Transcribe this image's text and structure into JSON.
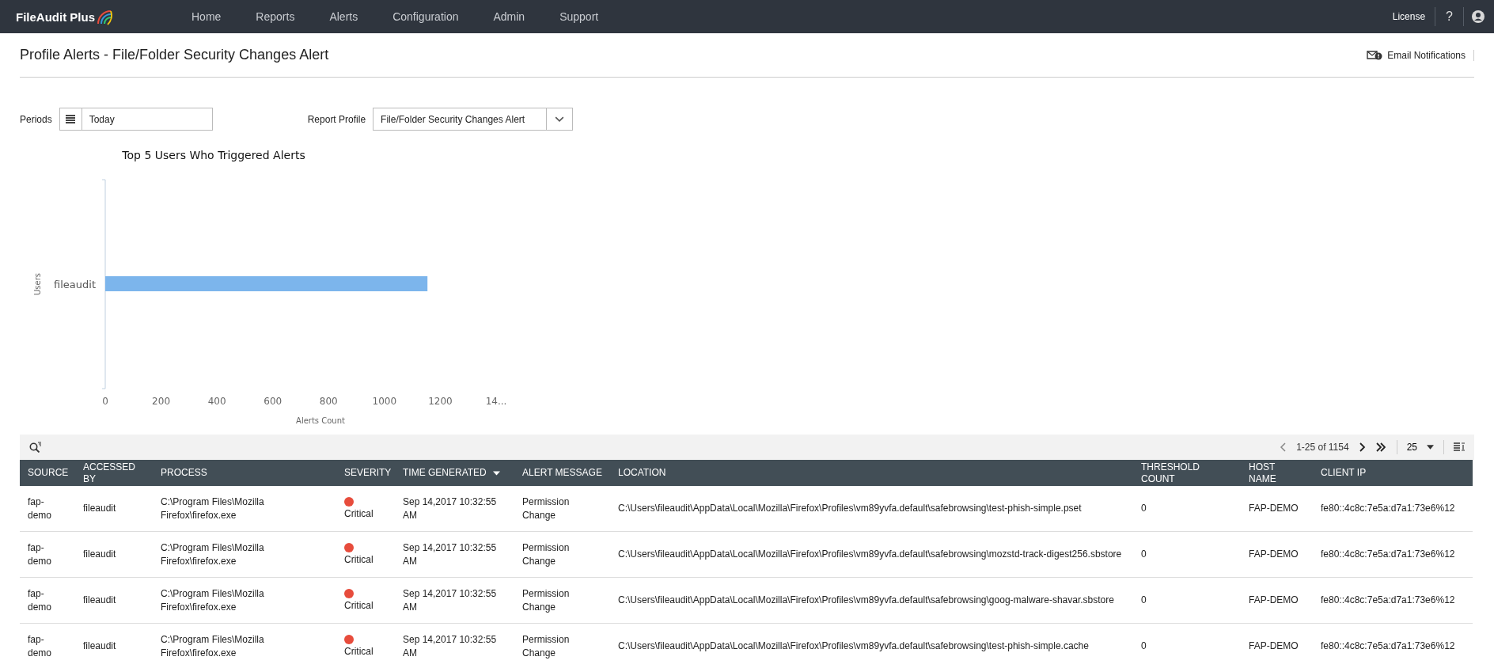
{
  "header": {
    "logo": "FileAudit Plus",
    "nav": [
      "Home",
      "Reports",
      "Alerts",
      "Configuration",
      "Admin",
      "Support"
    ],
    "license": "License",
    "help": "?"
  },
  "page": {
    "title": "Profile Alerts - File/Folder Security Changes Alert",
    "email_notifications": "Email Notifications"
  },
  "filters": {
    "periods_label": "Periods",
    "periods_value": "Today",
    "profile_label": "Report Profile",
    "profile_value": "File/Folder Security Changes Alert"
  },
  "chart": {
    "chart_data": {
      "type": "bar",
      "orientation": "horizontal",
      "title": "Top 5 Users Who Triggered Alerts",
      "xlabel": "Alerts Count",
      "ylabel": "Users",
      "categories": [
        "fileaudit"
      ],
      "series": [
        {
          "color": "#7cb5ec",
          "values": [
            1154
          ]
        }
      ],
      "xlim": [
        0,
        1400
      ],
      "xticks": [
        0,
        200,
        400,
        600,
        800,
        1000,
        1200,
        {
          "value": 1400,
          "label": "14..."
        }
      ]
    }
  },
  "pager": {
    "range": "1-25 of 1154",
    "page_size": "25"
  },
  "table": {
    "columns": [
      {
        "label": "SOURCE",
        "sorted": false
      },
      {
        "label": "ACCESSED BY",
        "sorted": false
      },
      {
        "label": "PROCESS",
        "sorted": false
      },
      {
        "label": "SEVERITY",
        "sorted": false
      },
      {
        "label": "TIME GENERATED",
        "sorted": true
      },
      {
        "label": "ALERT MESSAGE",
        "sorted": false
      },
      {
        "label": "LOCATION",
        "sorted": false
      },
      {
        "label": "THRESHOLD COUNT",
        "sorted": false
      },
      {
        "label": "HOST NAME",
        "sorted": false
      },
      {
        "label": "CLIENT IP",
        "sorted": false
      }
    ],
    "rows": [
      {
        "source": "fap-demo",
        "accessed_by": "fileaudit",
        "process": "C:\\Program Files\\Mozilla Firefox\\firefox.exe",
        "severity": {
          "label": "Critical",
          "color": "#e74c3c"
        },
        "time": "Sep 14,2017 10:32:55 AM",
        "message": "Permission Change",
        "location": "C:\\Users\\fileaudit\\AppData\\Local\\Mozilla\\Firefox\\Profiles\\vm89yvfa.default\\safebrowsing\\test-phish-simple.pset",
        "threshold": "0",
        "host": "FAP-DEMO",
        "ip": "fe80::4c8c:7e5a:d7a1:73e6%12"
      },
      {
        "source": "fap-demo",
        "accessed_by": "fileaudit",
        "process": "C:\\Program Files\\Mozilla Firefox\\firefox.exe",
        "severity": {
          "label": "Critical",
          "color": "#e74c3c"
        },
        "time": "Sep 14,2017 10:32:55 AM",
        "message": "Permission Change",
        "location": "C:\\Users\\fileaudit\\AppData\\Local\\Mozilla\\Firefox\\Profiles\\vm89yvfa.default\\safebrowsing\\mozstd-track-digest256.sbstore",
        "threshold": "0",
        "host": "FAP-DEMO",
        "ip": "fe80::4c8c:7e5a:d7a1:73e6%12"
      },
      {
        "source": "fap-demo",
        "accessed_by": "fileaudit",
        "process": "C:\\Program Files\\Mozilla Firefox\\firefox.exe",
        "severity": {
          "label": "Critical",
          "color": "#e74c3c"
        },
        "time": "Sep 14,2017 10:32:55 AM",
        "message": "Permission Change",
        "location": "C:\\Users\\fileaudit\\AppData\\Local\\Mozilla\\Firefox\\Profiles\\vm89yvfa.default\\safebrowsing\\goog-malware-shavar.sbstore",
        "threshold": "0",
        "host": "FAP-DEMO",
        "ip": "fe80::4c8c:7e5a:d7a1:73e6%12"
      },
      {
        "source": "fap-demo",
        "accessed_by": "fileaudit",
        "process": "C:\\Program Files\\Mozilla Firefox\\firefox.exe",
        "severity": {
          "label": "Critical",
          "color": "#e74c3c"
        },
        "time": "Sep 14,2017 10:32:55 AM",
        "message": "Permission Change",
        "location": "C:\\Users\\fileaudit\\AppData\\Local\\Mozilla\\Firefox\\Profiles\\vm89yvfa.default\\safebrowsing\\test-phish-simple.cache",
        "threshold": "0",
        "host": "FAP-DEMO",
        "ip": "fe80::4c8c:7e5a:d7a1:73e6%12"
      }
    ]
  }
}
